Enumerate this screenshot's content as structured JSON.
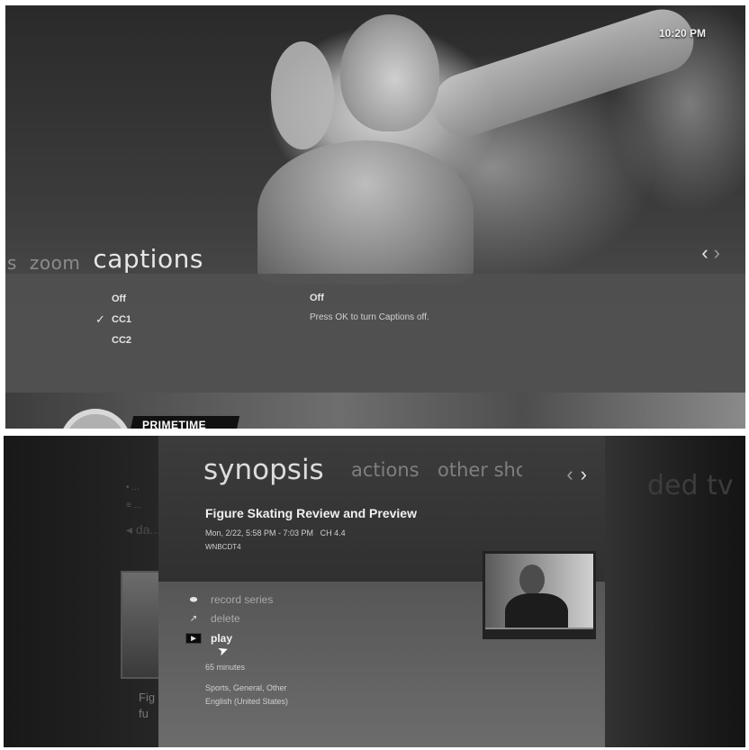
{
  "top": {
    "clock": "10:20 PM",
    "tabs": [
      {
        "label": "s",
        "active": false
      },
      {
        "label": "zoom",
        "active": false
      },
      {
        "label": "captions",
        "active": true
      }
    ],
    "captions": {
      "options": [
        "Off",
        "CC1",
        "CC2"
      ],
      "selected": "CC1",
      "detail_title": "Off",
      "detail_text": "Press OK to turn Captions off."
    },
    "branding": "PRIMETIME"
  },
  "bottom": {
    "background": {
      "section_title": "ded tv",
      "menu_items": [
        "• ...",
        "≡ ...",
        "◂ da..."
      ],
      "thumb_caption_1": "Fig",
      "thumb_caption_2": "fu"
    },
    "tabs": [
      {
        "label": "synopsis",
        "active": true
      },
      {
        "label": "actions",
        "active": false
      },
      {
        "label": "other sho",
        "active": false
      }
    ],
    "program": {
      "title": "Figure Skating Review and Preview",
      "schedule": "Mon, 2/22, 5:58 PM - 7:03 PM",
      "channel_num": "CH 4.4",
      "station": "WNBCDT4",
      "duration": "65 minutes",
      "genre": "Sports, General, Other",
      "language": "English (United States)"
    },
    "actions": [
      {
        "label": "record series",
        "icon": "record-icon",
        "active": false
      },
      {
        "label": "delete",
        "icon": "delete-icon",
        "active": false
      },
      {
        "label": "play",
        "icon": "play-icon",
        "active": true
      }
    ]
  }
}
